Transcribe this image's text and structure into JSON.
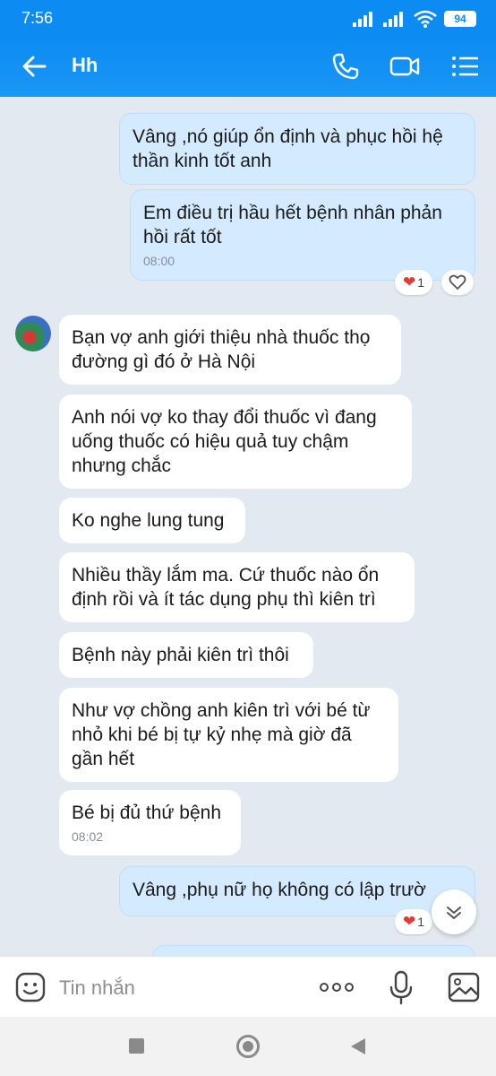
{
  "status": {
    "time": "7:56",
    "battery": "94"
  },
  "header": {
    "title": "Hh"
  },
  "messages": {
    "m1": "Vâng ,nó giúp ổn định và phục hồi hệ thần kinh tốt anh",
    "m2": "Em điều trị hầu hết bệnh nhân phản hồi rất tốt",
    "m2_time": "08:00",
    "m3": "Bạn vợ anh giới thiệu nhà thuốc thọ đường gì đó ở Hà Nội",
    "m4": "Anh nói vợ ko thay đổi thuốc vì đang uống thuốc có hiệu quả tuy chậm nhưng chắc",
    "m5": "Ko nghe lung tung",
    "m6": "Nhiều thầy lắm ma. Cứ thuốc nào ổn định rồi và ít tác dụng phụ thì kiên trì",
    "m7": "Bệnh này phải kiên trì thôi",
    "m8": "Như vợ chồng anh kiên trì với bé từ nhỏ khi bé bị tự kỷ nhẹ mà giờ đã gần hết",
    "m9": "Bé bị đủ thứ bệnh",
    "m9_time": "08:02",
    "m10": "Vâng ,phụ nữ họ không có lập trườ"
  },
  "reactions": {
    "r1_count": "1",
    "r2_count": "1"
  },
  "input": {
    "placeholder": "Tin nhắn"
  },
  "colors": {
    "accent": "#0c8bf2",
    "outgoing_bubble": "#d4eaff",
    "background": "#e2e9f1"
  }
}
